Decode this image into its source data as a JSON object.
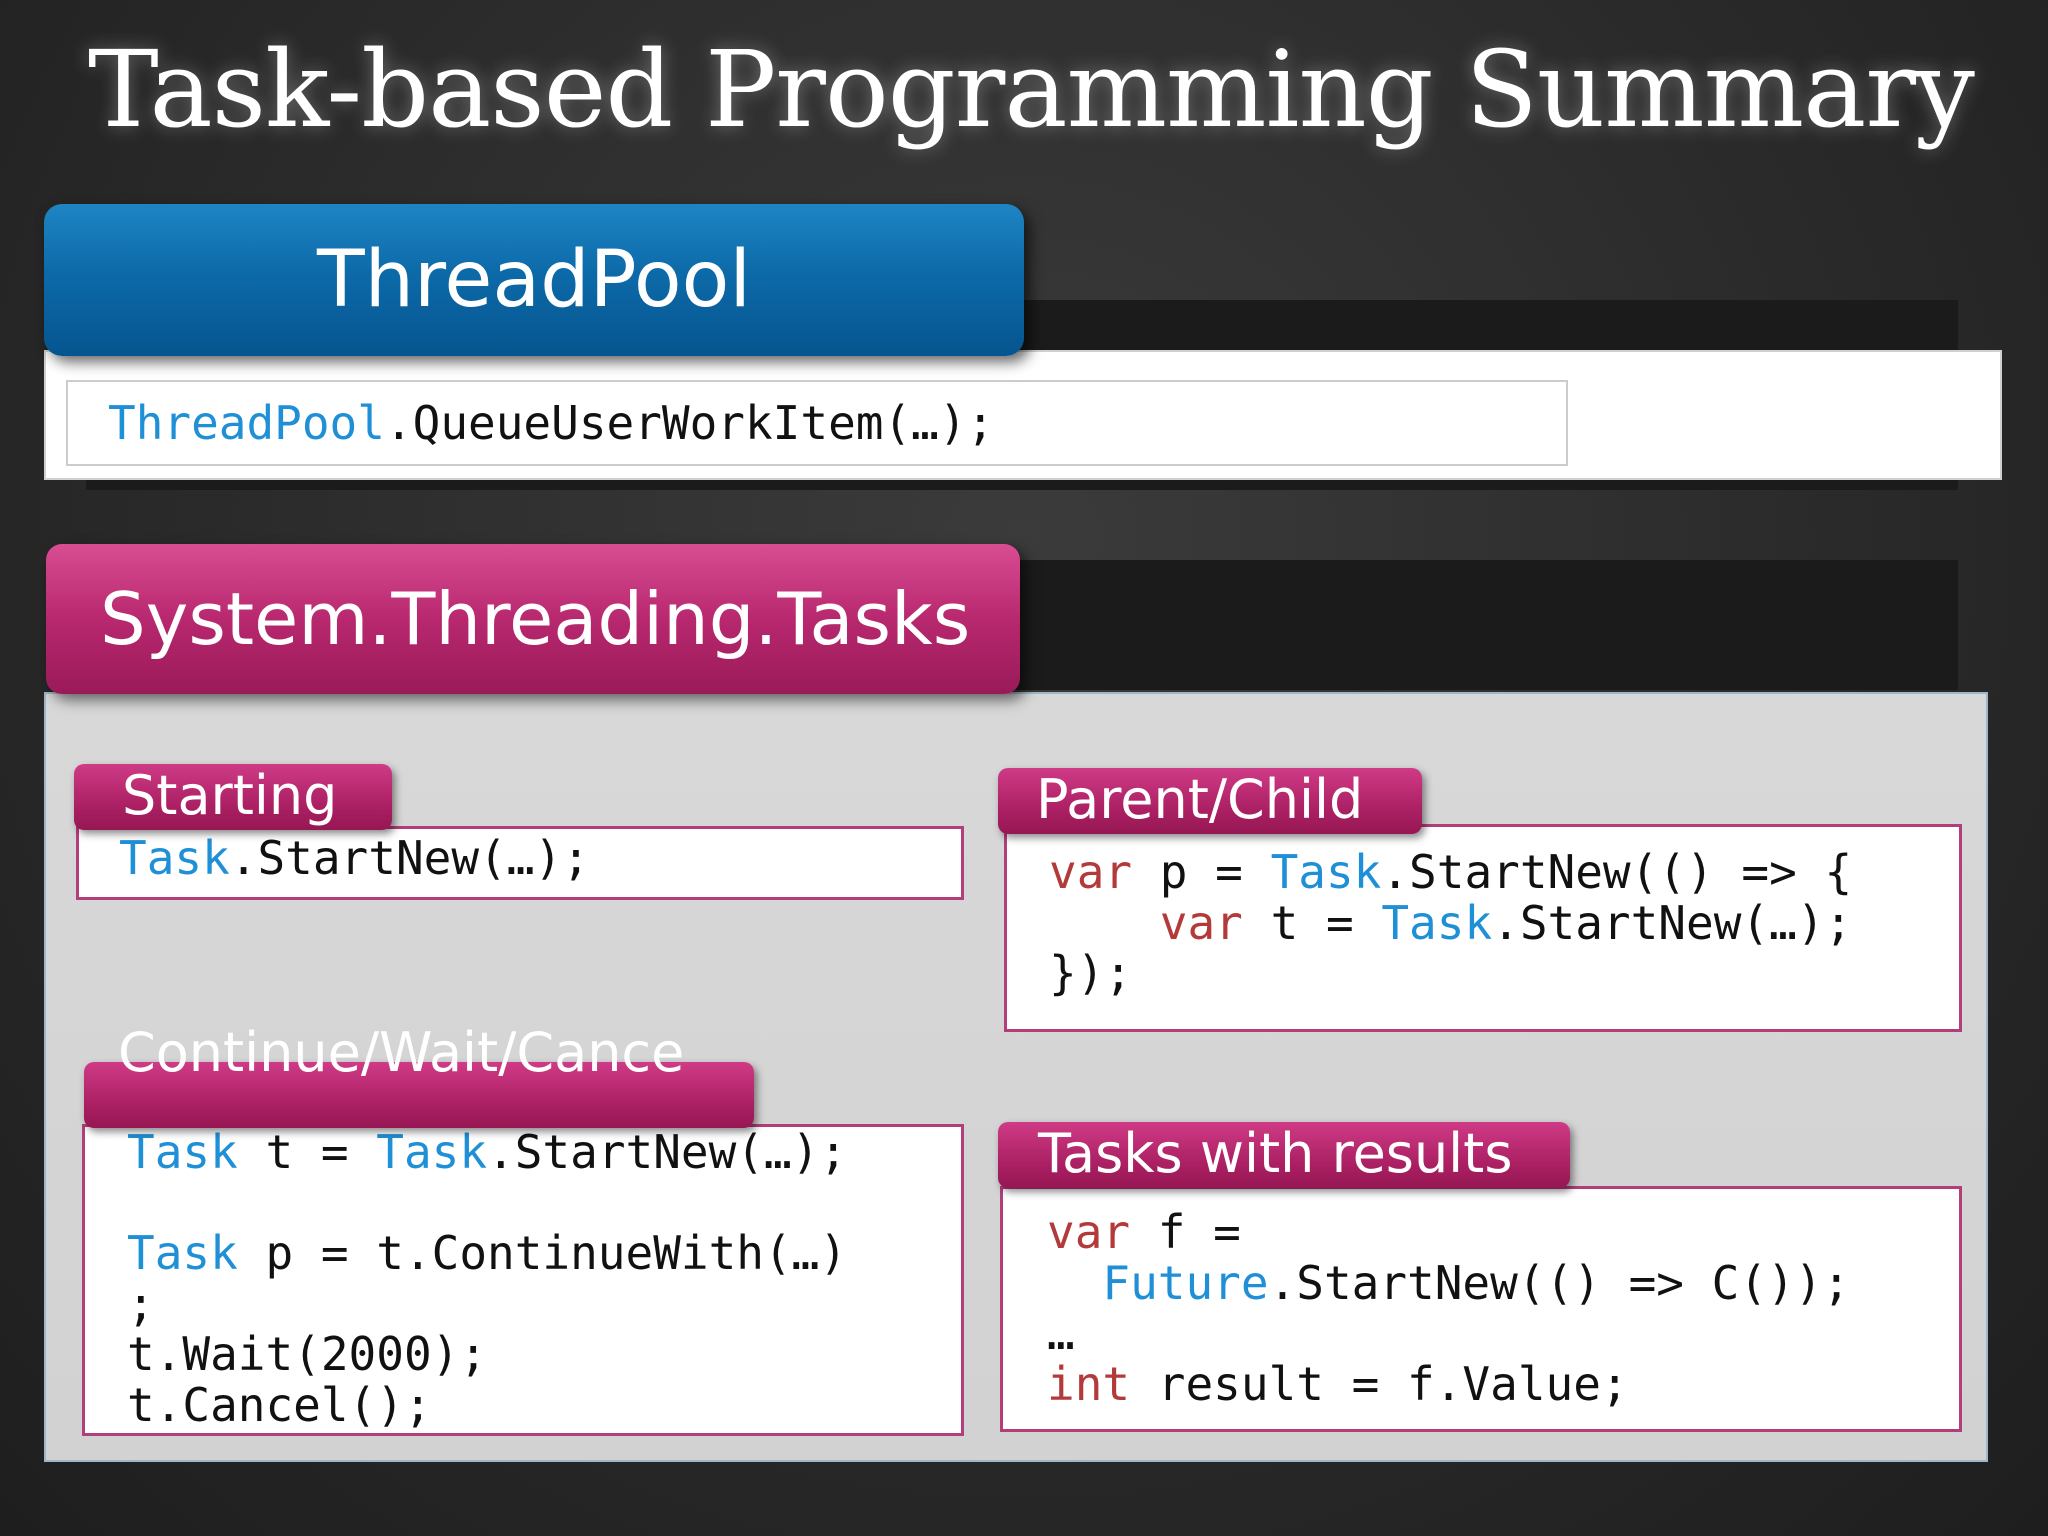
{
  "title": "Task-based Programming Summary",
  "threadpool": {
    "header": "ThreadPool",
    "code": {
      "type": "ThreadPool",
      "rest": ".QueueUserWorkItem(…);"
    }
  },
  "tasks": {
    "header": "System.Threading.Tasks",
    "starting": {
      "tab": "Starting",
      "line1": {
        "type": "Task",
        "rest": ".StartNew(…);"
      }
    },
    "parent_child": {
      "tab": "Parent/Child",
      "line1": {
        "kw": "var",
        "mid": " p = ",
        "type": "Task",
        "rest": ".StartNew(() => {"
      },
      "line2": {
        "indent": "    ",
        "kw": "var",
        "mid": " t = ",
        "type": "Task",
        "rest": ".StartNew(…);"
      },
      "line3": "});"
    },
    "continue": {
      "tab": "Continue/Wait/Cance",
      "line1": {
        "type": "Task",
        "mid": " t = ",
        "type2": "Task",
        "rest": ".StartNew(…);"
      },
      "line2": {
        "type": "Task",
        "rest": " p = t.ContinueWith(…)"
      },
      "line3": ";",
      "line4": "t.Wait(2000);",
      "line5": "t.Cancel();"
    },
    "results": {
      "tab": "Tasks with results",
      "line1": {
        "kw": "var",
        "rest": " f ="
      },
      "line2": {
        "indent": "  ",
        "type": "Future",
        "rest": ".StartNew(() => C());"
      },
      "line3": "…",
      "line4": {
        "kw": "int",
        "rest": " result = f.Value;"
      }
    }
  },
  "colors": {
    "blue_header": "#0d6aa9",
    "pink_header": "#b8286f",
    "code_type": "#1f8fd6",
    "code_keyword": "#b33a3a"
  }
}
